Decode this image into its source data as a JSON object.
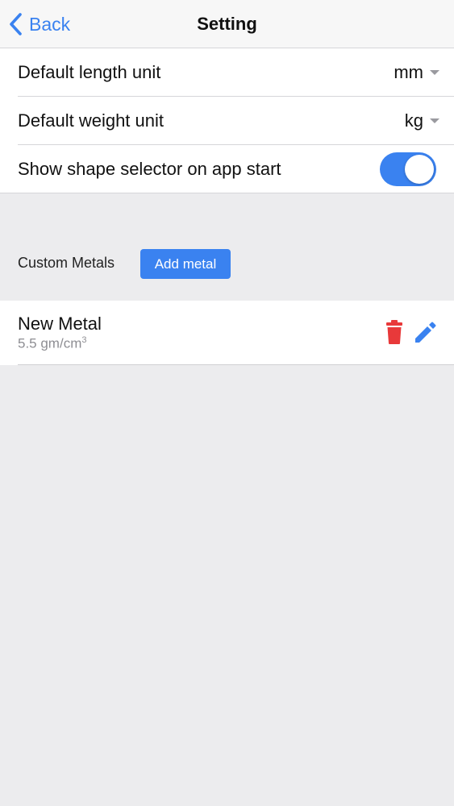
{
  "nav": {
    "back_label": "Back",
    "title": "Setting"
  },
  "settings": {
    "length_unit": {
      "label": "Default length unit",
      "value": "mm"
    },
    "weight_unit": {
      "label": "Default weight unit",
      "value": "kg"
    },
    "shape_selector": {
      "label": "Show shape selector on app start",
      "enabled": true
    }
  },
  "custom_metals": {
    "label": "Custom Metals",
    "add_button": "Add metal",
    "items": [
      {
        "name": "New Metal",
        "density_value": "5.5 gm/cm",
        "density_exp": "3"
      }
    ]
  },
  "icons": {
    "back": "chevron-left-icon",
    "delete": "trash-icon",
    "edit": "pencil-icon"
  },
  "colors": {
    "accent": "#3a82f0",
    "danger": "#e8393a",
    "background": "#ececee"
  }
}
